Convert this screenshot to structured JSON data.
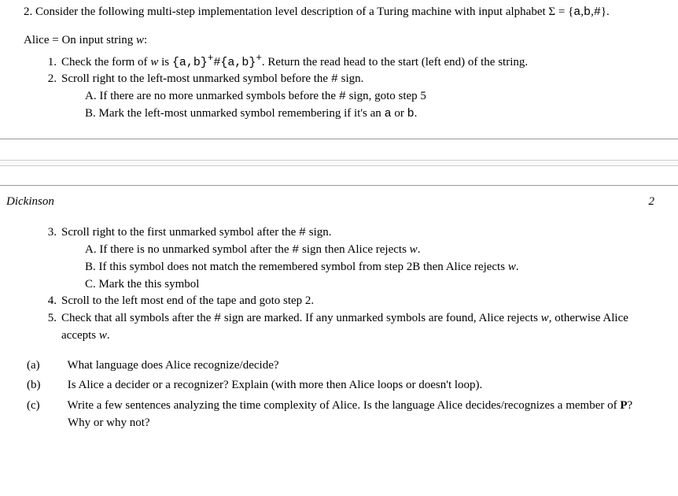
{
  "q_number": "2.",
  "q_text_a": "Consider the following multi-step implementation level description of a Turing machine with input alphabet",
  "alphabet": "Σ = {a,b,#}.",
  "algo_name": "Alice",
  "algo_on_input": "= On input string ",
  "var_w": "w",
  "colon": ":",
  "steps": {
    "s1": {
      "n": "1.",
      "text_a": "Check the form of ",
      "w": "w",
      "text_b": " is ",
      "re": "{a,b}⁺#{a,b}⁺",
      "text_c": ". Return the read head to the start (left end) of the string."
    },
    "s2": {
      "n": "2.",
      "text": "Scroll right to the left-most unmarked symbol before the # sign."
    },
    "s2a": {
      "n": "A.",
      "text": "If there are no more unmarked symbols before the # sign, goto step 5"
    },
    "s2b": {
      "n": "B.",
      "text_a": "Mark the left-most unmarked symbol remembering if it's an ",
      "tt_a": "a",
      "text_b": " or ",
      "tt_b": "b",
      "text_c": "."
    },
    "s3": {
      "n": "3.",
      "text": "Scroll right to the first unmarked symbol after the # sign."
    },
    "s3a": {
      "n": "A.",
      "text_a": "If there is no unmarked symbol after the # sign then Alice rejects ",
      "w": "w",
      "dot": "."
    },
    "s3b": {
      "n": "B.",
      "text_a": "If this symbol does not match the remembered symbol from step 2B then Alice rejects ",
      "w": "w",
      "dot": "."
    },
    "s3c": {
      "n": "C.",
      "text": "Mark the this symbol"
    },
    "s4": {
      "n": "4.",
      "text": "Scroll to the left most end of the tape and goto step 2."
    },
    "s5": {
      "n": "5.",
      "text_a": "Check that all symbols after the # sign are marked. If any unmarked symbols are found, Alice rejects ",
      "w": "w",
      "text_b": ", otherwise Alice accepts ",
      "w2": "w",
      "dot": "."
    }
  },
  "parts": {
    "a": {
      "n": "(a)",
      "text": "What language does Alice recognize/decide?"
    },
    "b": {
      "n": "(b)",
      "text": "Is Alice a decider or a recognizer? Explain (with more then Alice loops or doesn't loop)."
    },
    "c": {
      "n": "(c)",
      "text_a": "Write a few sentences analyzing the time complexity of Alice. Is the language Alice decides/recognizes a member of ",
      "P": "P",
      "text_b": "? Why or why not?"
    }
  },
  "header": {
    "left": "Dickinson",
    "right": "2"
  }
}
